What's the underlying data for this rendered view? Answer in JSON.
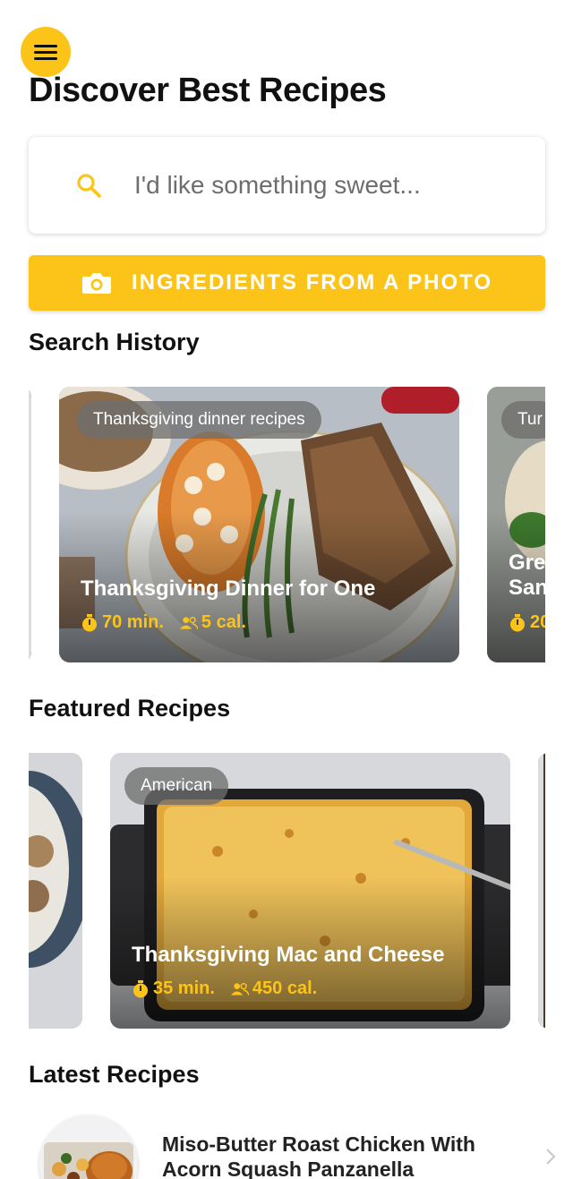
{
  "header": {
    "title": "Discover Best Recipes",
    "menu_icon": "hamburger-menu-icon"
  },
  "search": {
    "placeholder": "I'd like something sweet...",
    "icon": "search-icon"
  },
  "photo_button": {
    "label": "INGREDIENTS FROM A PHOTO",
    "icon": "camera-icon"
  },
  "colors": {
    "accent": "#fcc419",
    "text": "#111111"
  },
  "search_history": {
    "title": "Search History",
    "cards": [
      {
        "tag": "Thanksgiving dinner recipes",
        "title": "Thanksgiving Dinner for One",
        "time": "70 min.",
        "cal": "5 cal."
      },
      {
        "tag": "Tur",
        "title_line1": "Gre",
        "title_line2": "San",
        "time": "20"
      }
    ]
  },
  "featured": {
    "title": "Featured Recipes",
    "cards": [
      {
        "tag": "American",
        "title": "Thanksgiving Mac and Cheese",
        "time": "35 min.",
        "cal": "450 cal."
      }
    ]
  },
  "latest": {
    "title": "Latest Recipes",
    "items": [
      {
        "title_line1": "Miso-Butter Roast Chicken With",
        "title_line2": "Acorn Squash Panzanella"
      }
    ]
  }
}
